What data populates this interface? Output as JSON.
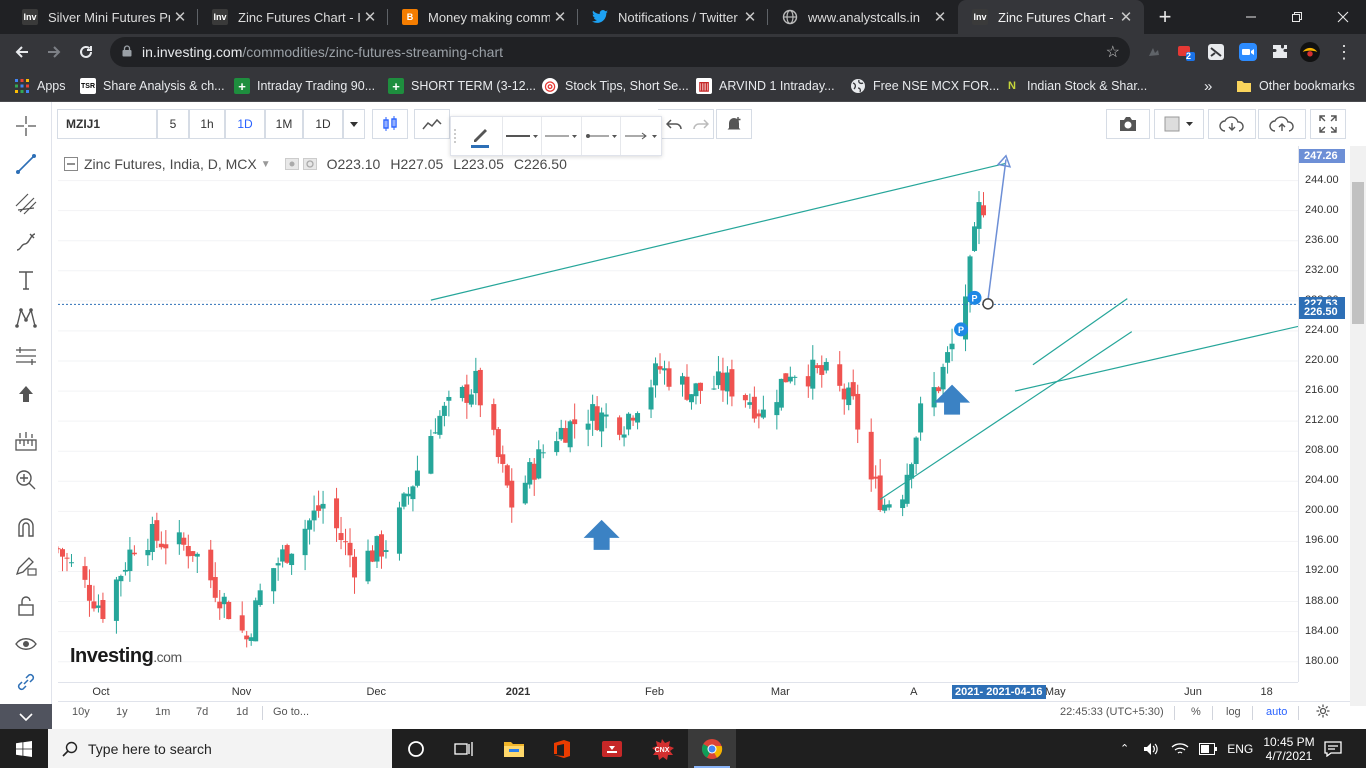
{
  "browser": {
    "tabs": [
      {
        "title": "Silver Mini Futures Price",
        "icon": "investing-icon",
        "icon_text": "Inv"
      },
      {
        "title": "Zinc Futures Chart - Inv",
        "icon": "investing-icon",
        "icon_text": "Inv"
      },
      {
        "title": "Money making commo",
        "icon": "blogger-icon",
        "icon_text": "B"
      },
      {
        "title": "Notifications / Twitter",
        "icon": "twitter-icon",
        "icon_text": ""
      },
      {
        "title": "www.analystcalls.in",
        "icon": "globe-icon",
        "icon_text": ""
      },
      {
        "title": "Zinc Futures Chart - Inv",
        "icon": "investing-icon",
        "icon_text": "Inv",
        "active": true
      }
    ],
    "new_tab_symbol": "+",
    "url_host": "in.investing.com",
    "url_path": "/commodities/zinc-futures-streaming-chart",
    "extension_badge": "2",
    "bookmarks": [
      {
        "label": "Apps",
        "icon": "apps-grid-icon"
      },
      {
        "label": "Share Analysis & ch...",
        "icon": "tsr-icon",
        "icon_text": "TSR"
      },
      {
        "label": "Intraday Trading 90...",
        "icon": "green-plus-icon",
        "icon_text": "+"
      },
      {
        "label": "SHORT TERM (3-12...",
        "icon": "green-plus-icon",
        "icon_text": "+"
      },
      {
        "label": "Stock Tips, Short Se...",
        "icon": "target-icon",
        "icon_text": "◎"
      },
      {
        "label": "ARVIND 1 Intraday...",
        "icon": "chart-icon",
        "icon_text": "▥"
      },
      {
        "label": "Free NSE MCX FOR...",
        "icon": "globe-icon",
        "icon_text": ""
      },
      {
        "label": "Indian Stock & Shar...",
        "icon": "n-icon",
        "icon_text": "N"
      }
    ],
    "bookmarks_overflow": "»",
    "other_bookmarks": "Other bookmarks"
  },
  "chart_toolbar": {
    "symbol": "MZIJ1",
    "intervals": [
      "5",
      "1h",
      "1D",
      "1M",
      "1D"
    ],
    "selected_interval_index": 2
  },
  "legend": {
    "title": "Zinc Futures, India, D, MCX",
    "open_label": "O",
    "open": "223.10",
    "high_label": "H",
    "high": "227.05",
    "low_label": "L",
    "low": "223.05",
    "close_label": "C",
    "close": "226.50"
  },
  "logo": {
    "text": "Investing",
    "suffix": ".com"
  },
  "price_axis": {
    "ticks": [
      "244.00",
      "240.00",
      "236.00",
      "232.00",
      "228.00",
      "224.00",
      "220.00",
      "216.00",
      "212.00",
      "208.00",
      "204.00",
      "200.00",
      "196.00",
      "192.00",
      "188.00",
      "184.00",
      "180.00"
    ],
    "tags": [
      {
        "label": "247.26",
        "color": "#6d8fd6"
      },
      {
        "label": "227.53",
        "color": "#2d6fb6"
      },
      {
        "label": "226.50",
        "color": "#2d6fb6"
      }
    ]
  },
  "time_axis": {
    "ticks": [
      "Oct",
      "Nov",
      "Dec",
      "2021",
      "Feb",
      "Mar",
      "A",
      "May",
      "Jun",
      "18"
    ],
    "range_tag": "2021- 2021-04-16"
  },
  "bottom_bar": {
    "ranges": [
      "10y",
      "1y",
      "1m",
      "7d",
      "1d"
    ],
    "goto": "Go to...",
    "time": "22:45:33 (UTC+5:30)",
    "percent": "%",
    "log": "log",
    "auto": "auto"
  },
  "taskbar": {
    "search_placeholder": "Type here to search",
    "apps": [
      "cortana-icon",
      "task-view-icon",
      "file-explorer-icon",
      "office-icon",
      "media-app-icon",
      "cnx-app-icon",
      "chrome-icon"
    ],
    "cnx_label": "CNX",
    "language": "ENG",
    "time": "10:45 PM",
    "date": "4/7/2021"
  },
  "colors": {
    "up": "#26a69a",
    "down": "#ef5350",
    "trendline": "#26a69a",
    "horizontal_line": "#2d6fb6",
    "arrow": "#3b82c4",
    "projection": "#6d8fd6"
  },
  "chart_data": {
    "type": "candlestick",
    "title": "Zinc Futures, India, D, MCX",
    "xlabel": "",
    "ylabel": "",
    "ylim": [
      177.3,
      248.6
    ],
    "x_ticks": [
      "Oct",
      "Nov",
      "Dec",
      "2021",
      "Feb",
      "Mar",
      "A",
      "May",
      "Jun",
      "18"
    ],
    "y_ticks": [
      180,
      184,
      188,
      192,
      196,
      200,
      204,
      208,
      212,
      216,
      220,
      224,
      228,
      232,
      236,
      240,
      244
    ],
    "horizontal_line": 227.53,
    "last_price": 226.5,
    "projection_target": 247.26,
    "anchors": [
      {
        "date": "2020-09-22",
        "price": 195
      },
      {
        "date": "2020-10-02",
        "price": 187
      },
      {
        "date": "2020-10-10",
        "price": 197
      },
      {
        "date": "2020-10-22",
        "price": 195
      },
      {
        "date": "2020-10-30",
        "price": 187
      },
      {
        "date": "2020-11-03",
        "price": 183
      },
      {
        "date": "2020-11-07",
        "price": 191
      },
      {
        "date": "2020-11-20",
        "price": 201
      },
      {
        "date": "2020-11-27",
        "price": 193
      },
      {
        "date": "2020-12-05",
        "price": 196
      },
      {
        "date": "2020-12-15",
        "price": 212
      },
      {
        "date": "2020-12-24",
        "price": 217
      },
      {
        "date": "2021-01-01",
        "price": 201
      },
      {
        "date": "2021-01-10",
        "price": 210
      },
      {
        "date": "2021-01-18",
        "price": 213
      },
      {
        "date": "2021-01-26",
        "price": 212
      },
      {
        "date": "2021-02-03",
        "price": 219
      },
      {
        "date": "2021-02-10",
        "price": 216
      },
      {
        "date": "2021-02-18",
        "price": 217
      },
      {
        "date": "2021-02-23",
        "price": 215
      },
      {
        "date": "2021-02-26",
        "price": 213
      },
      {
        "date": "2021-03-04",
        "price": 219
      },
      {
        "date": "2021-03-12",
        "price": 218
      },
      {
        "date": "2021-03-18",
        "price": 214
      },
      {
        "date": "2021-03-22",
        "price": 204
      },
      {
        "date": "2021-03-25",
        "price": 201
      },
      {
        "date": "2021-03-29",
        "price": 203
      },
      {
        "date": "2021-04-02",
        "price": 213
      },
      {
        "date": "2021-04-06",
        "price": 217
      },
      {
        "date": "2021-04-09",
        "price": 222
      },
      {
        "date": "2021-04-11",
        "price": 226
      },
      {
        "date": "2021-04-13",
        "price": 232
      },
      {
        "date": "2021-04-15",
        "price": 240
      },
      {
        "date": "2021-04-16",
        "price": 241
      }
    ]
  }
}
